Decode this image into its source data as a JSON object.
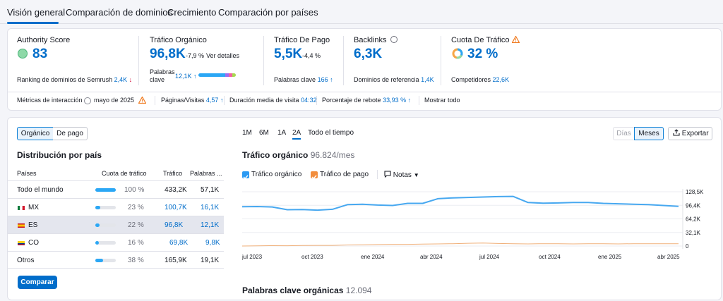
{
  "tabs": [
    "Visión general",
    "Comparación de dominios",
    "Crecimiento",
    "Comparación por países"
  ],
  "metrics": {
    "authority": {
      "title": "Authority Score",
      "value": "83",
      "sub_label": "Ranking de dominios de Semrush",
      "sub_value": "2,4K",
      "trend": "↓"
    },
    "organic": {
      "title": "Tráfico Orgánico",
      "value": "96,8K",
      "change": "-7,9 %",
      "link": "Ver detalles",
      "kw_label_1": "Palabras",
      "kw_label_2": "clave",
      "kw_value": "12,1K",
      "trend": "↑"
    },
    "paid": {
      "title": "Tráfico De Pago",
      "value": "5,5K",
      "change": "-4,4 %",
      "sub_label": "Palabras clave",
      "sub_value": "166",
      "trend": "↑"
    },
    "backlinks": {
      "title": "Backlinks",
      "value": "6,3K",
      "sub_label": "Dominios de referencia",
      "sub_value": "1,4K"
    },
    "share": {
      "title": "Cuota De Tráfico",
      "value": "32 %",
      "sub_label": "Competidores",
      "sub_value": "22,6K"
    }
  },
  "engagement": {
    "label": "Métricas de interacción",
    "date": "mayo de 2025",
    "pages_label": "Páginas/Visitas",
    "pages_value": "4,57",
    "pages_trend": "↑",
    "duration_label": "Duración media de visita",
    "duration_value": "04:32",
    "bounce_label": "Porcentaje de rebote",
    "bounce_value": "33,93 %",
    "bounce_trend": "↑",
    "show_all": "Mostrar todo"
  },
  "toggle": {
    "organic": "Orgánico",
    "paid": "De pago"
  },
  "distribution": {
    "title": "Distribución por país",
    "headers": [
      "Países",
      "Cuota de tráfico",
      "Tráfico",
      "Palabras ..."
    ],
    "rows": [
      {
        "country": "Todo el mundo",
        "share": "100 %",
        "share_pct": 100,
        "traffic": "433,2K",
        "keywords": "57,1K"
      },
      {
        "country": "MX",
        "share": "23 %",
        "share_pct": 23,
        "traffic": "100,7K",
        "keywords": "16,1K"
      },
      {
        "country": "ES",
        "share": "22 %",
        "share_pct": 22,
        "traffic": "96,8K",
        "keywords": "12,1K"
      },
      {
        "country": "CO",
        "share": "16 %",
        "share_pct": 16,
        "traffic": "69,8K",
        "keywords": "9,8K"
      },
      {
        "country": "Otros",
        "share": "38 %",
        "share_pct": 38,
        "traffic": "165,9K",
        "keywords": "19,1K"
      }
    ],
    "compare_button": "Comparar"
  },
  "periods": [
    "1M",
    "6M",
    "1A",
    "2A",
    "Todo el tiempo"
  ],
  "view_toggle": {
    "days": "Días",
    "months": "Meses"
  },
  "export_button": "Exportar",
  "chart_title": "Tráfico orgánico",
  "chart_value": "96.824/mes",
  "legend": {
    "organic": "Tráfico orgánico",
    "paid": "Tráfico de pago",
    "notes": "Notas"
  },
  "bottom_title": "Palabras clave orgánicas",
  "bottom_value": "12.094",
  "colors": {
    "accent": "#006dca",
    "organic_line": "#47a8f0",
    "paid_line": "#f0b07a",
    "negative": "#d1002f",
    "authority": "#8ed9a8"
  },
  "chart_data": {
    "type": "line",
    "x_ticks": [
      "jul 2023",
      "oct 2023",
      "ene 2024",
      "abr 2024",
      "jul 2024",
      "oct 2024",
      "ene 2025",
      "abr 2025"
    ],
    "y_ticks": [
      "128,5K",
      "96,4K",
      "64,2K",
      "32,1K",
      "0"
    ],
    "ylim": [
      0,
      128500
    ],
    "series": [
      {
        "name": "Tráfico orgánico",
        "values": [
          93000,
          93500,
          92500,
          86000,
          86500,
          85000,
          87000,
          98000,
          99000,
          97000,
          96000,
          101000,
          101000,
          112000,
          114000,
          115000,
          116000,
          117000,
          117500,
          103000,
          101500,
          102000,
          103000,
          103000,
          101000,
          100000,
          99000,
          98000,
          96000,
          94000
        ]
      },
      {
        "name": "Tráfico de pago",
        "values": [
          0,
          500,
          800,
          700,
          1200,
          1500,
          1500,
          2500,
          3000,
          3500,
          4000,
          4000,
          4500,
          5000,
          5500,
          6500,
          7000,
          6000,
          5500,
          5000,
          5500,
          5500,
          5000,
          5500,
          5500,
          5000,
          5500,
          5500,
          5500,
          5500
        ]
      }
    ]
  }
}
